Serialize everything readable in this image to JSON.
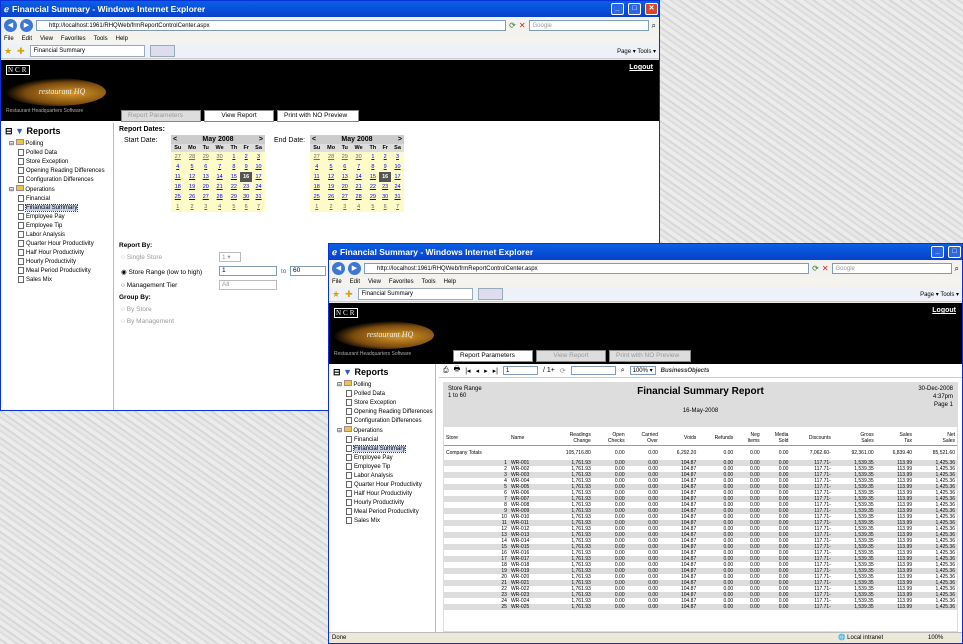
{
  "win1": {
    "title": "Financial Summary - Windows Internet Explorer",
    "url": "http://localhost:1961/RHQWeb/frmReportControlCenter.aspx",
    "search_placeholder": "Google",
    "menus": [
      "File",
      "Edit",
      "View",
      "Favorites",
      "Tools",
      "Help"
    ],
    "tab": "Financial Summary",
    "tools": "Page ▾  Tools ▾"
  },
  "win2": {
    "title": "Financial Summary - Windows Internet Explorer",
    "url": "http://localhost:1961/RHQWeb/frmReportControlCenter.aspx",
    "search_placeholder": "Google",
    "menus": [
      "File",
      "Edit",
      "View",
      "Favorites",
      "Tools",
      "Help"
    ],
    "tab": "Financial Summary",
    "tools": "Page ▾  Tools ▾",
    "status": "Done",
    "zone": "Local intranet",
    "zoom": "100%"
  },
  "brand": {
    "ncr": "NCR",
    "logo": "restaurant HQ",
    "sub": "Restaurant Headquarters Software",
    "logout": "Logout"
  },
  "buttons": {
    "params": "Report Parameters",
    "view": "View Report",
    "print": "Print with NO Preview"
  },
  "tree": {
    "root": "Reports",
    "polling": "Polling",
    "polling_items": [
      "Polled Data",
      "Store Exception",
      "Opening Reading Differences",
      "Configuration Differences"
    ],
    "operations": "Operations",
    "operations_items": [
      "Financial",
      "Financial Summary",
      "Employee Pay",
      "Employee Tip",
      "Labor Analysis",
      "Quarter Hour Productivity",
      "Half Hour Productivity",
      "Hourly Productivity",
      "Meal Period Productivity",
      "Sales Mix"
    ],
    "selected": "Financial Summary"
  },
  "params": {
    "dates_label": "Report Dates:",
    "start_label": "Start Date:",
    "end_label": "End Date:",
    "month": "May 2008",
    "dow": [
      "Su",
      "Mo",
      "Tu",
      "We",
      "Th",
      "Fr",
      "Sa"
    ],
    "weeks": [
      [
        "27",
        "28",
        "29",
        "30",
        "1",
        "2",
        "3"
      ],
      [
        "4",
        "5",
        "6",
        "7",
        "8",
        "9",
        "10"
      ],
      [
        "11",
        "12",
        "13",
        "14",
        "15",
        "16",
        "17"
      ],
      [
        "18",
        "19",
        "20",
        "21",
        "22",
        "23",
        "24"
      ],
      [
        "25",
        "26",
        "27",
        "28",
        "29",
        "30",
        "31"
      ],
      [
        "1",
        "2",
        "3",
        "4",
        "5",
        "6",
        "7"
      ]
    ],
    "selected_day": "16",
    "report_by": "Report By:",
    "single_store": "Single Store",
    "single_val": "1",
    "store_range": "Store Range (low to high)",
    "range_from": "1",
    "range_to_label": "to",
    "range_to": "60",
    "mgmt_tier": "Management Tier",
    "mgmt_val": "All",
    "group_by": "Group By:",
    "by_store": "By Store",
    "by_mgmt": "By Management"
  },
  "viewer": {
    "page": "1",
    "of": "/ 1+",
    "zoom": "100%",
    "bo": "BusinessObjects"
  },
  "report": {
    "left1": "Store Range",
    "left2": "1 to 60",
    "title": "Financial Summary Report",
    "date": "16-May-2008",
    "right1": "30-Dec-2008",
    "right2": "4:37pm",
    "right3": "Page 1",
    "headers": [
      [
        "Store",
        "Name"
      ],
      [
        "",
        "Name"
      ],
      [
        "Readings",
        "Change"
      ],
      [
        "Open",
        "Checks"
      ],
      [
        "Carried",
        "Over"
      ],
      [
        "",
        "Voids"
      ],
      [
        "",
        "Refunds"
      ],
      [
        "Neg",
        "Items"
      ],
      [
        "Media",
        "Sold"
      ],
      [
        "",
        "Discounts"
      ],
      [
        "Gross",
        "Sales"
      ],
      [
        "Sales",
        "Tax"
      ],
      [
        "Net",
        "Sales"
      ]
    ],
    "totals": [
      "Company Totals",
      "",
      "105,716.80",
      "0.00",
      "0.00",
      "6,292.20",
      "0.00",
      "0.00",
      "0.00",
      "7,062.60-",
      "92,361.00",
      "6,839.40",
      "85,521.60"
    ],
    "row_vals": [
      "1,761.93",
      "0.00",
      "0.00",
      "104.87",
      "0.00",
      "0.00",
      "0.00",
      "117.71-",
      "1,539.35",
      "113.99",
      "1,425.36"
    ],
    "stores": [
      "1",
      "2",
      "3",
      "4",
      "5",
      "6",
      "7",
      "8",
      "9",
      "10",
      "11",
      "12",
      "13",
      "14",
      "15",
      "16",
      "17",
      "18",
      "19",
      "20",
      "21",
      "22",
      "23",
      "24",
      "25"
    ],
    "names": [
      "WR-001",
      "WR-002",
      "WR-003",
      "WR-004",
      "WR-005",
      "WR-006",
      "WR-007",
      "WR-008",
      "WR-009",
      "WR-010",
      "WR-011",
      "WR-012",
      "WR-013",
      "WR-014",
      "WR-015",
      "WR-016",
      "WR-017",
      "WR-018",
      "WR-019",
      "WR-020",
      "WR-021",
      "WR-022",
      "WR-023",
      "WR-024",
      "WR-025"
    ]
  }
}
